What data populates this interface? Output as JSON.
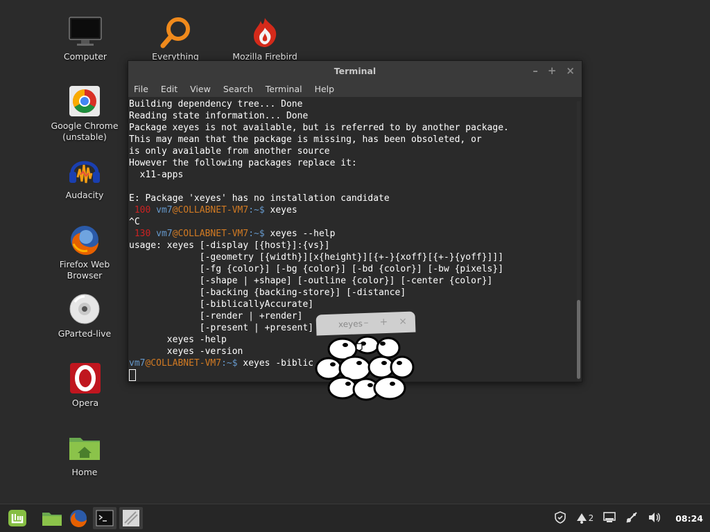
{
  "desktop": {
    "icons": [
      {
        "label": "Computer",
        "icon": "computer-icon"
      },
      {
        "label": "Everything",
        "icon": "search-icon"
      },
      {
        "label": "Mozilla Firebird",
        "icon": "firebird-icon"
      },
      {
        "label": "Google Chrome\n(unstable)",
        "icon": "chrome-icon"
      },
      {
        "label": "Audacity",
        "icon": "audacity-icon"
      },
      {
        "label": "Firefox Web\nBrowser",
        "icon": "firefox-icon"
      },
      {
        "label": "GParted-live",
        "icon": "disc-icon"
      },
      {
        "label": "Opera",
        "icon": "opera-icon"
      },
      {
        "label": "Home",
        "icon": "home-folder-icon"
      }
    ]
  },
  "terminal": {
    "title": "Terminal",
    "menu": [
      "File",
      "Edit",
      "View",
      "Search",
      "Terminal",
      "Help"
    ],
    "lines": {
      "l1": "Building dependency tree... Done",
      "l2": "Reading state information... Done",
      "l3": "Package xeyes is not available, but is referred to by another package.",
      "l4": "This may mean that the package is missing, has been obsoleted, or",
      "l5": "is only available from another source",
      "l6": "However the following packages replace it:",
      "l7": "  x11-apps",
      "l8": "",
      "l9": "E: Package 'xeyes' has no installation candidate",
      "p1_code": " 100 ",
      "p1_user": "vm7",
      "p1_at": "@COLLABNET-VM7",
      "p1_path": ":~$",
      "p1_cmd": " xeyes",
      "l11": "^C",
      "p2_code": " 130 ",
      "p2_user": "vm7",
      "p2_at": "@COLLABNET-VM7",
      "p2_path": ":~$",
      "p2_cmd": " xeyes --help",
      "u1": "usage: xeyes [-display [{host}]:{vs}]",
      "u2": "             [-geometry [{width}][x{height}][{+-}{xoff}[{+-}{yoff}]]]",
      "u3": "             [-fg {color}] [-bg {color}] [-bd {color}] [-bw {pixels}]",
      "u4": "             [-shape | +shape] [-outline {color}] [-center {color}]",
      "u5": "             [-backing {backing-store}] [-distance]",
      "u6": "             [-biblicallyAccurate]",
      "u7": "             [-render | +render]",
      "u8": "             [-present | +present]",
      "u9": "       xeyes -help",
      "u10": "       xeyes -version",
      "p3_user": "vm7",
      "p3_at": "@COLLABNET-VM7",
      "p3_path": ":~$",
      "p3_cmd": " xeyes -biblic"
    }
  },
  "xeyes": {
    "title": "xeyes",
    "minimize": "–",
    "maximize": "+",
    "close": "×"
  },
  "window_controls": {
    "minimize": "–",
    "maximize": "+",
    "close": "×"
  },
  "taskbar": {
    "workspace_count": "2",
    "clock": "08:24"
  }
}
